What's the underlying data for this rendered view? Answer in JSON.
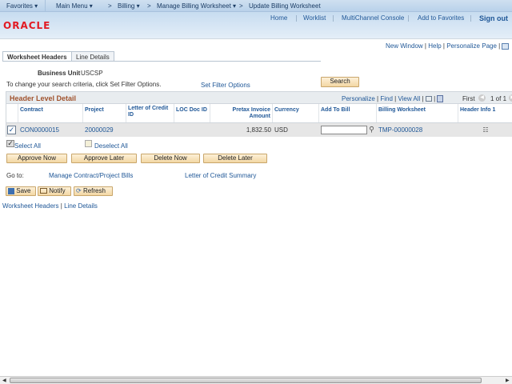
{
  "nav": {
    "favorites": "Favorites ▾",
    "main_menu": "Main Menu ▾",
    "billing": "Billing ▾",
    "manage": "Manage Billing Worksheet ▾",
    "current": "Update Billing Worksheet",
    "sep": ">"
  },
  "header": {
    "links": [
      "Home",
      "Worklist",
      "MultiChannel Console",
      "Add to Favorites"
    ],
    "signout": "Sign out",
    "logo": "ORACLE"
  },
  "pagebar": {
    "new_window": "New Window",
    "help": "Help",
    "personalize_page": "Personalize Page"
  },
  "tabs": [
    {
      "label": "Worksheet Headers",
      "active": true
    },
    {
      "label": "Line Details",
      "active": false
    }
  ],
  "filter": {
    "bu_label": "Business Unit",
    "bu_value": "USCSP",
    "instruction": "To change your search criteria, click Set Filter Options.",
    "set_filter": "Set Filter Options",
    "search": "Search"
  },
  "grid": {
    "title": "Header Level Detail",
    "personalize": "Personalize",
    "find": "Find",
    "view_all": "View All",
    "first": "First",
    "count": "1 of 1",
    "columns": [
      "Contract",
      "Project",
      "Letter of Credit ID",
      "LOC Doc ID",
      "Pretax Invoice Amount",
      "Currency",
      "Add To Bill",
      "Billing Worksheet",
      "Header Info 1"
    ],
    "rows": [
      {
        "checked": true,
        "contract": "CON0000015",
        "project": "20000029",
        "loc_id": "",
        "loc_doc": "",
        "amount": "1,832.50",
        "currency": "USD",
        "add_to_bill": "",
        "worksheet": "TMP-00000028"
      }
    ]
  },
  "actions": {
    "select_all": "Select All",
    "deselect_all": "Deselect All",
    "approve_now": "Approve Now",
    "approve_later": "Approve Later",
    "delete_now": "Delete Now",
    "delete_later": "Delete Later"
  },
  "goto": {
    "label": "Go to:",
    "manage": "Manage Contract/Project Bills",
    "loc_summary": "Letter of Credit Summary"
  },
  "toolbar": {
    "save": "Save",
    "notify": "Notify",
    "refresh": "Refresh"
  },
  "footer": {
    "worksheet_headers": "Worksheet Headers",
    "line_details": "Line Details",
    "sep": "|"
  },
  "colors": {
    "accent": "#1f5797",
    "title": "#a0522d",
    "oracle": "#e21b24",
    "button": "#f3d7a4"
  }
}
